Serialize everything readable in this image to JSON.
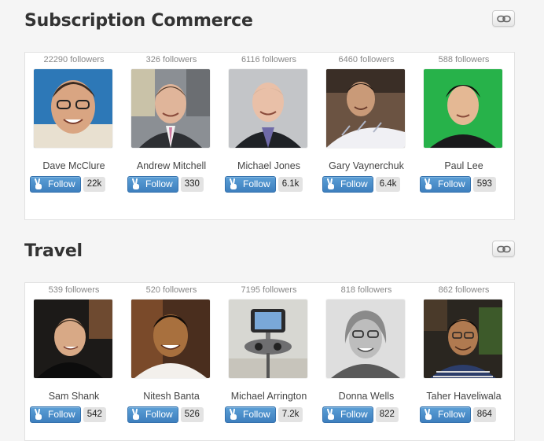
{
  "sections": [
    {
      "title": "Subscription Commerce",
      "link_icon": "link-icon",
      "people": [
        {
          "followers_text": "22290 followers",
          "name": "Dave McClure",
          "follow_label": "Follow",
          "count": "22k",
          "avatar_icon": "avatar-photo"
        },
        {
          "followers_text": "326 followers",
          "name": "Andrew Mitchell",
          "follow_label": "Follow",
          "count": "330",
          "avatar_icon": "avatar-photo"
        },
        {
          "followers_text": "6116 followers",
          "name": "Michael Jones",
          "follow_label": "Follow",
          "count": "6.1k",
          "avatar_icon": "avatar-photo"
        },
        {
          "followers_text": "6460 followers",
          "name": "Gary Vaynerchuk",
          "follow_label": "Follow",
          "count": "6.4k",
          "avatar_icon": "avatar-photo"
        },
        {
          "followers_text": "588 followers",
          "name": "Paul Lee",
          "follow_label": "Follow",
          "count": "593",
          "avatar_icon": "avatar-photo"
        }
      ]
    },
    {
      "title": "Travel",
      "link_icon": "link-icon",
      "people": [
        {
          "followers_text": "539 followers",
          "name": "Sam Shank",
          "follow_label": "Follow",
          "count": "542",
          "avatar_icon": "avatar-photo"
        },
        {
          "followers_text": "520 followers",
          "name": "Nitesh Banta",
          "follow_label": "Follow",
          "count": "526",
          "avatar_icon": "avatar-photo"
        },
        {
          "followers_text": "7195 followers",
          "name": "Michael Arrington",
          "follow_label": "Follow",
          "count": "7.2k",
          "avatar_icon": "avatar-photo"
        },
        {
          "followers_text": "818 followers",
          "name": "Donna Wells",
          "follow_label": "Follow",
          "count": "822",
          "avatar_icon": "avatar-photo"
        },
        {
          "followers_text": "862 followers",
          "name": "Taher Haveliwala",
          "follow_label": "Follow",
          "count": "864",
          "avatar_icon": "avatar-photo"
        }
      ]
    }
  ],
  "colors": {
    "follow_button": "#4a8cc9",
    "count_badge": "#e3e3e3",
    "page_background": "#f5f5f5",
    "panel_background": "#ffffff"
  }
}
